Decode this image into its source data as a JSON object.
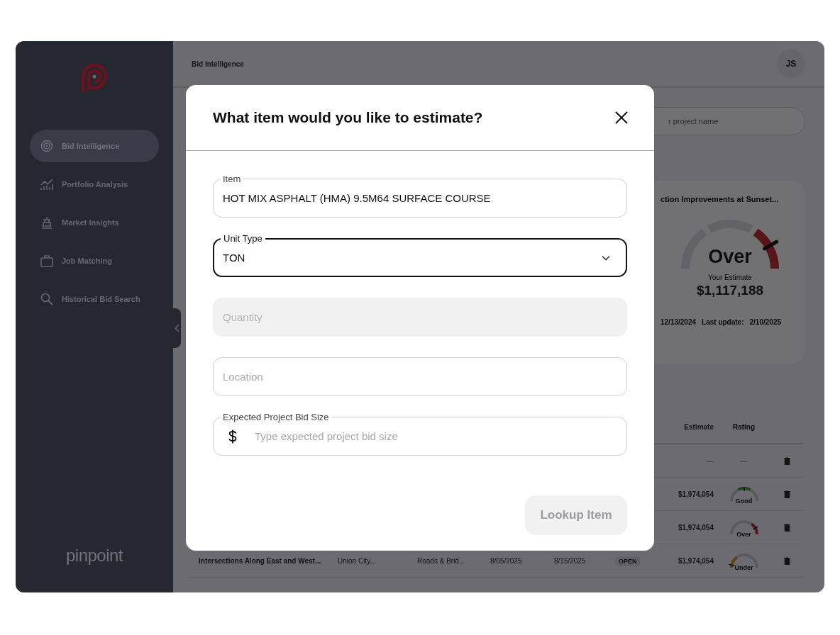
{
  "sidebar": {
    "nav": [
      {
        "label": "Bid Intelligence",
        "kind": "target",
        "selected": true
      },
      {
        "label": "Portfolio Analysis",
        "kind": "chart",
        "selected": false
      },
      {
        "label": "Market Insights",
        "kind": "monument",
        "selected": false
      },
      {
        "label": "Job Matching",
        "kind": "briefcase",
        "selected": false
      },
      {
        "label": "Historical Bid Search",
        "kind": "search",
        "selected": false
      }
    ],
    "brand": "pinpoint"
  },
  "header": {
    "title": "Bid Intelligence",
    "avatar": "JS"
  },
  "search": {
    "placeholder": "r project name"
  },
  "project_card": {
    "title": "ction Improvements at Sunset...",
    "rating": "Over",
    "kind": "over",
    "estimate_label": "Your Estimate",
    "estimate": "$1,117,188",
    "date": "12/13/2024",
    "update_label": "Last update:",
    "update": "2/10/2025"
  },
  "table": {
    "columns": [
      "Estimate",
      "Rating"
    ],
    "rows": [
      {
        "estimate": "—",
        "rating": "—",
        "kind": "none"
      },
      {
        "estimate": "$1,974,054",
        "rating": "Good",
        "kind": "good"
      },
      {
        "estimate": "$1,974,054",
        "rating": "Over",
        "kind": "over"
      },
      {
        "name": "Intersections Along East and West...",
        "location": "Union City...",
        "category": "Roads & Brid...",
        "start": "8/05/2025",
        "end": "8/15/2025",
        "status": "OPEN",
        "estimate": "$1,974,054",
        "rating": "Under",
        "kind": "under"
      }
    ]
  },
  "modal": {
    "title": "What item would you like to estimate?",
    "fields": [
      {
        "kind": "text",
        "label": "Item",
        "value": "HOT MIX ASPHALT (HMA) 9.5M64 SURFACE COURSE",
        "focused": false,
        "disabled": false
      },
      {
        "kind": "select",
        "label": "Unit Type",
        "value": "TON",
        "focused": true,
        "disabled": false
      },
      {
        "kind": "text",
        "placeholder": "Quantity",
        "focused": false,
        "disabled": true
      },
      {
        "kind": "text",
        "placeholder": "Location",
        "focused": false,
        "disabled": false
      },
      {
        "kind": "currency",
        "label": "Expected Project Bid Size",
        "placeholder": "Type expected project bid size",
        "focused": false,
        "disabled": false
      }
    ],
    "button": {
      "label": "Lookup Item",
      "disabled": true
    }
  }
}
